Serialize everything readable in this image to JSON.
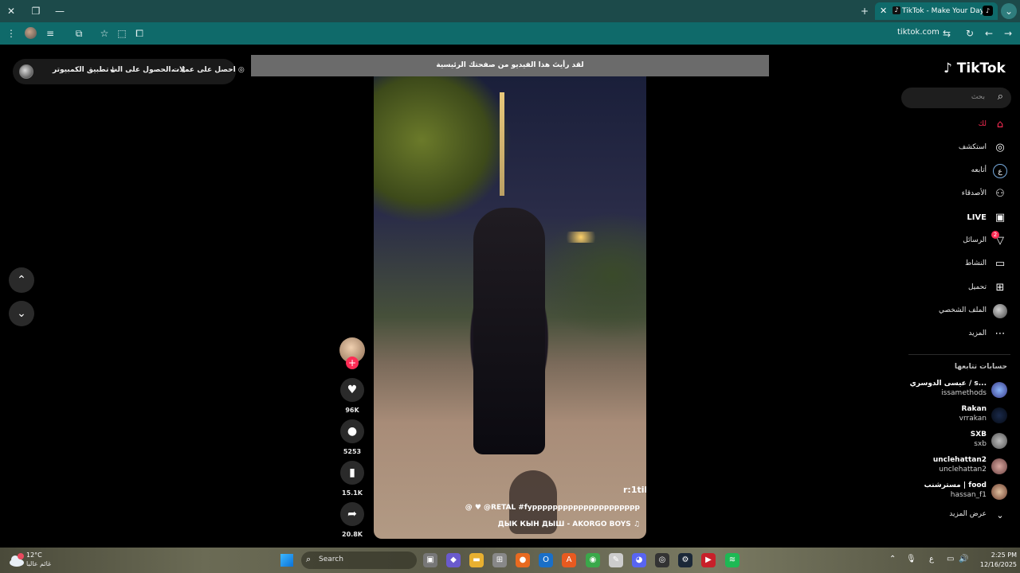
{
  "browser": {
    "tab_title": "TikTok - Make Your Day",
    "url": "tiktok.com"
  },
  "top_pill": {
    "get_coins": "احصل على عملات",
    "get_app": "الحصول على الت...",
    "desktop_app": "تطبيق الكمبيوتر"
  },
  "notice": "لقد رأيتَ هذا الفيديو من صفحتك الرئيسية",
  "video": {
    "username": "r:1til",
    "description": "@ ♥ @RETAL #fyppppppppppppppppppppp",
    "music": "ДЫК КЫН ДЫШ - AKORGO BOYS ♫"
  },
  "actions": {
    "likes": "96K",
    "comments": "5253",
    "saves": "15.1K",
    "shares": "20.8K"
  },
  "sidebar": {
    "logo": "TikTok",
    "search_placeholder": "بحث",
    "nav": [
      {
        "label": "لك",
        "icon": "home-icon"
      },
      {
        "label": "استكشف",
        "icon": "compass-icon"
      },
      {
        "label": "أتابعه",
        "icon": "following-icon"
      },
      {
        "label": "الأصدقاء",
        "icon": "friends-icon"
      },
      {
        "label": "LIVE",
        "icon": "live-icon"
      },
      {
        "label": "الرسائل",
        "icon": "messages-icon",
        "badge": "2"
      },
      {
        "label": "النشاط",
        "icon": "activity-icon"
      },
      {
        "label": "تحميل",
        "icon": "upload-icon"
      },
      {
        "label": "الملف الشخصي",
        "icon": "profile-avatar"
      },
      {
        "label": "المزيد",
        "icon": "more-icon"
      }
    ],
    "following_title": "حسابات تتابعها",
    "following": [
      {
        "name": "عيسى الدوسري / s...",
        "handle": "issamethods"
      },
      {
        "name": "Rakan",
        "handle": "vrrakan"
      },
      {
        "name": "SXB",
        "handle": "sxb"
      },
      {
        "name": "unclehattan2",
        "handle": "unclehattan2"
      },
      {
        "name": "مسترشنب | food",
        "handle": "hassan_f1"
      }
    ],
    "see_more": "عرض المزيد"
  },
  "taskbar": {
    "temperature": "12°C",
    "weather_desc": "غائم عالبا",
    "search_label": "Search",
    "time": "2:25 PM",
    "date": "12/16/2025",
    "lang": "ع"
  },
  "colors": {
    "accent": "#fe2c55",
    "tab_bg": "#0f6a6a",
    "titlebar_bg": "#1c4a4a"
  }
}
